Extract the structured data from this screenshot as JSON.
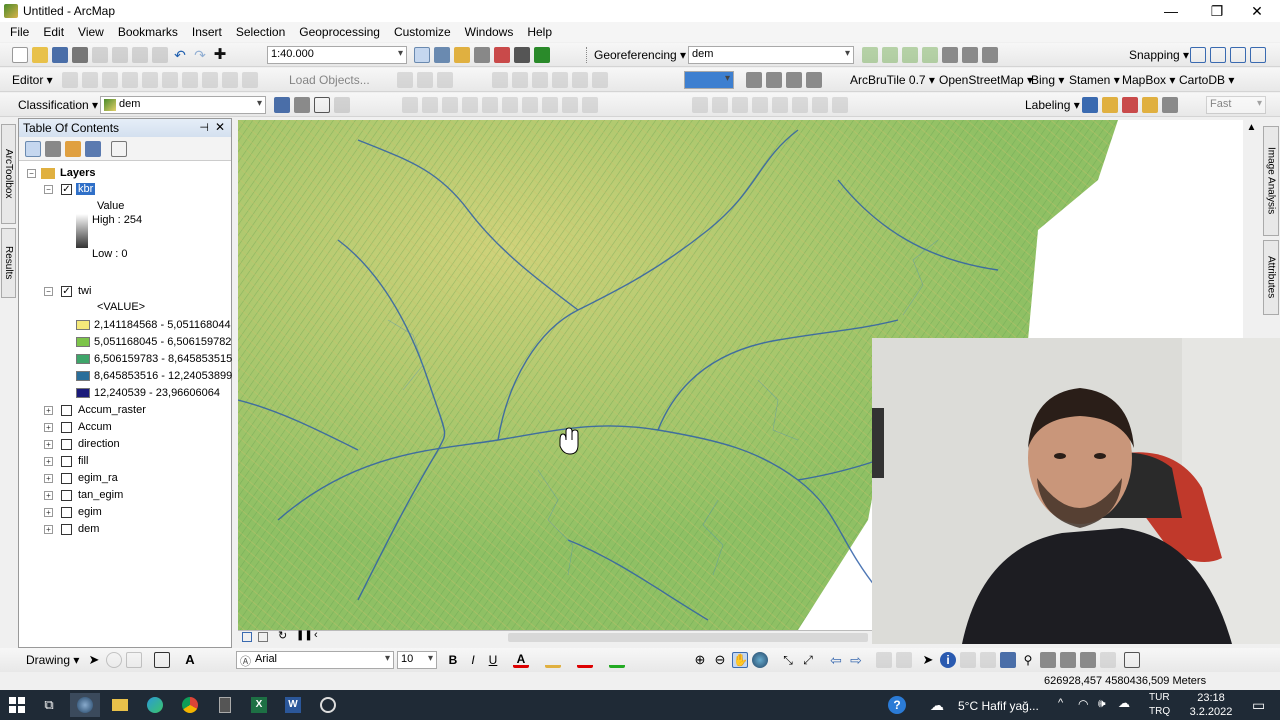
{
  "window": {
    "title": "Untitled - ArcMap",
    "minimize": "—",
    "maximize": "❐",
    "close": "✕"
  },
  "menu": [
    "File",
    "Edit",
    "View",
    "Bookmarks",
    "Insert",
    "Selection",
    "Geoprocessing",
    "Customize",
    "Windows",
    "Help"
  ],
  "toolbar1": {
    "scale": "1:40.000",
    "georeferencing": "Georeferencing ▾",
    "georef_layer": "dem",
    "snapping": "Snapping ▾"
  },
  "toolbar2": {
    "editor": "Editor ▾",
    "load_objects": "Load Objects...",
    "arcbrutile": "ArcBruTile 0.7 ▾",
    "osm": "OpenStreetMap ▾",
    "bing": "Bing ▾",
    "stamen": "Stamen ▾",
    "mapbox": "MapBox ▾",
    "cartodb": "CartoDB ▾"
  },
  "toolbar3": {
    "classification": "Classification ▾",
    "layer": "dem",
    "labeling": "Labeling ▾",
    "fast": "Fast"
  },
  "toc": {
    "title": "Table Of Contents",
    "root": "Layers",
    "kbr": {
      "name": "kbr",
      "checked": true,
      "value_label": "Value",
      "high": "High : 254",
      "low": "Low : 0"
    },
    "twi": {
      "name": "twi",
      "checked": true,
      "field": "<VALUE>",
      "classes": [
        {
          "label": "2,141184568 - 5,051168044",
          "color": "#f5e97a"
        },
        {
          "label": "5,051168045 - 6,506159782",
          "color": "#7dc44a"
        },
        {
          "label": "6,506159783 - 8,645853515",
          "color": "#3ea56a"
        },
        {
          "label": "8,645853516 - 12,24053899",
          "color": "#2a6e9a"
        },
        {
          "label": "12,240539 - 23,96606064",
          "color": "#1a1a7a"
        }
      ]
    },
    "others": [
      "Accum_raster",
      "Accum",
      "direction",
      "fill",
      "egim_ra",
      "tan_egim",
      "egim",
      "dem"
    ]
  },
  "left_tabs": [
    "ArcToolbox",
    "Results"
  ],
  "right_tabs": [
    "Image Analysis",
    "Attributes"
  ],
  "drawing": {
    "label": "Drawing ▾",
    "font": "Arial",
    "size": "10",
    "bold": "B",
    "italic": "I",
    "underline": "U",
    "font_color": "A"
  },
  "status": {
    "coords": "626928,457  4580436,509 Meters"
  },
  "taskbar": {
    "weather": "5°C  Hafif yağ...",
    "lang_top": "TUR",
    "lang_bottom": "TRQ",
    "time": "23:18",
    "date": "3.2.2022"
  }
}
